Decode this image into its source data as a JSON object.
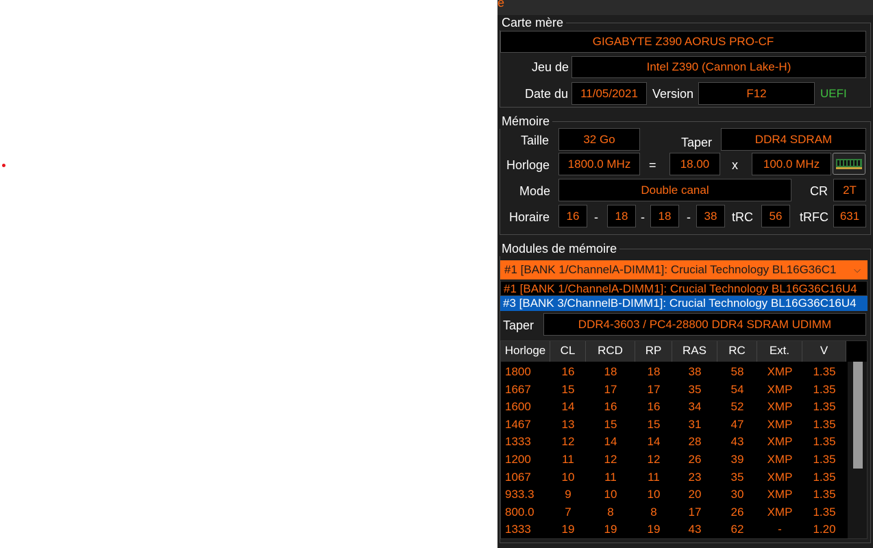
{
  "title_fragment": "e",
  "motherboard": {
    "section": "Carte mère",
    "model": "GIGABYTE Z390 AORUS PRO-CF",
    "chipset_label": "Jeu de",
    "chipset": "Intel Z390 (Cannon Lake-H)",
    "date_label": "Date du",
    "date": "11/05/2021",
    "version_label": "Version",
    "version": "F12",
    "uefi": "UEFI"
  },
  "memory": {
    "section": "Mémoire",
    "size_label": "Taille",
    "size": "32 Go",
    "type_label": "Taper",
    "type": "DDR4 SDRAM",
    "clock_label": "Horloge",
    "clock": "1800.0 MHz",
    "eq": "=",
    "multiplier": "18.00",
    "x": "x",
    "bus": "100.0 MHz",
    "mode_label": "Mode",
    "mode": "Double canal",
    "cr_label": "CR",
    "cr": "2T",
    "timing_label": "Horaire",
    "t1": "16",
    "d1": "-",
    "t2": "18",
    "d2": "-",
    "t3": "18",
    "d3": "-",
    "t4": "38",
    "trc_label": "tRC",
    "trc": "56",
    "trfc_label": "tRFC",
    "trfc": "631"
  },
  "modules": {
    "section": "Modules de mémoire",
    "selected": "#1 [BANK 1/ChannelA-DIMM1]: Crucial Technology BL16G36C1",
    "options": [
      "#1 [BANK 1/ChannelA-DIMM1]: Crucial Technology BL16G36C16U4",
      "#3 [BANK 3/ChannelB-DIMM1]: Crucial Technology BL16G36C16U4"
    ],
    "type_label": "Taper",
    "type": "DDR4-3603 / PC4-28800 DDR4 SDRAM UDIMM"
  },
  "spd_table": {
    "headers": [
      "Horloge",
      "CL",
      "RCD",
      "RP",
      "RAS",
      "RC",
      "Ext.",
      "V"
    ],
    "rows": [
      [
        "1800",
        "16",
        "18",
        "18",
        "38",
        "58",
        "XMP",
        "1.35"
      ],
      [
        "1667",
        "15",
        "17",
        "17",
        "35",
        "54",
        "XMP",
        "1.35"
      ],
      [
        "1600",
        "14",
        "16",
        "16",
        "34",
        "52",
        "XMP",
        "1.35"
      ],
      [
        "1467",
        "13",
        "15",
        "15",
        "31",
        "47",
        "XMP",
        "1.35"
      ],
      [
        "1333",
        "12",
        "14",
        "14",
        "28",
        "43",
        "XMP",
        "1.35"
      ],
      [
        "1200",
        "11",
        "12",
        "12",
        "26",
        "39",
        "XMP",
        "1.35"
      ],
      [
        "1067",
        "10",
        "11",
        "11",
        "23",
        "35",
        "XMP",
        "1.35"
      ],
      [
        "933.3",
        "9",
        "10",
        "10",
        "20",
        "30",
        "XMP",
        "1.35"
      ],
      [
        "800.0",
        "7",
        "8",
        "8",
        "17",
        "26",
        "XMP",
        "1.35"
      ],
      [
        "1333",
        "19",
        "19",
        "19",
        "43",
        "62",
        "-",
        "1.20"
      ]
    ]
  },
  "colors": {
    "accent": "#ff6a13",
    "panel_bg": "#1e1e1e",
    "selection": "#0a5fbd",
    "uefi": "#3fbf3f"
  }
}
